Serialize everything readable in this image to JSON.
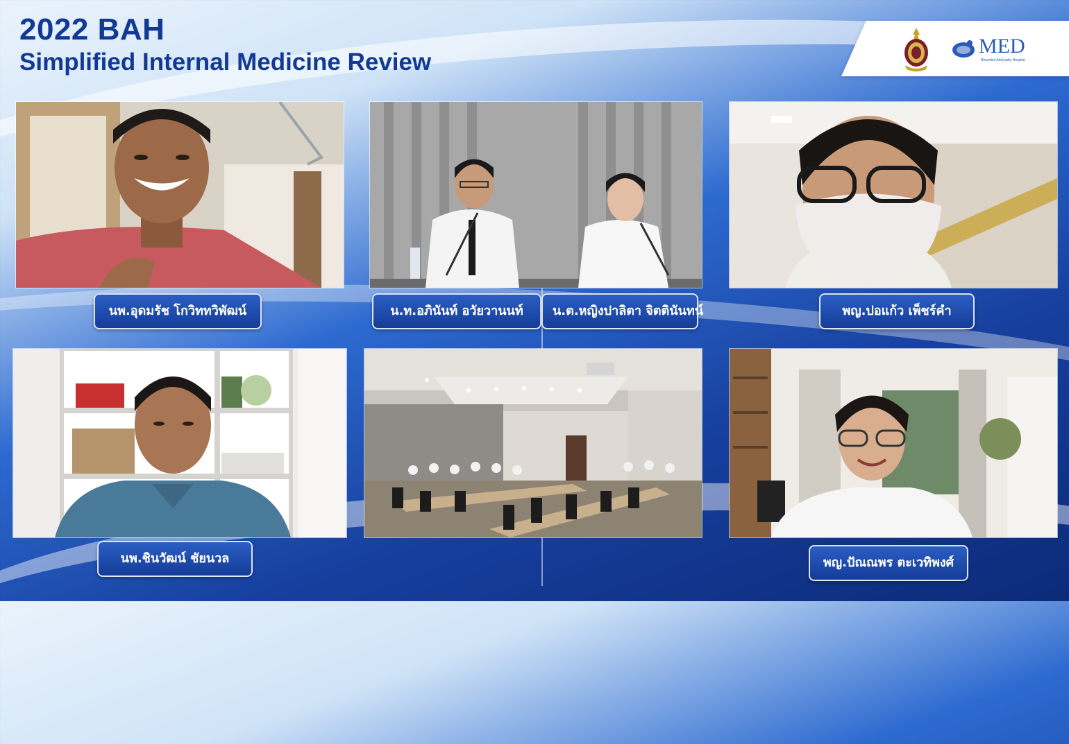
{
  "event": {
    "title_year": "2022 BAH",
    "title_sub": "Simplified Internal Medicine Review"
  },
  "logos": {
    "crest_icon": "royal-crest-icon",
    "med_text": "MED",
    "med_subtext": "Bhumibol Adulyadej Hospital"
  },
  "participants": [
    {
      "name": "นพ.อุดมรัช โกวิททวิพัฒน์"
    },
    {
      "name": "น.ท.อภินันท์ อวัยวานนท์"
    },
    {
      "name": "น.ต.หญิงปาลิตา จิตตินันทน์"
    },
    {
      "name": "พญ.ปอแก้ว เพ็ชร์คำ"
    },
    {
      "name": "นพ.ชินวัฒน์ ชัยนวล"
    },
    {
      "name": "พญ.ปัณณพร ตะเวทิพงศ์"
    }
  ],
  "colors": {
    "title": "#123a95",
    "label_bg": "#1f4fb3",
    "accent": "#2a5bb8"
  }
}
